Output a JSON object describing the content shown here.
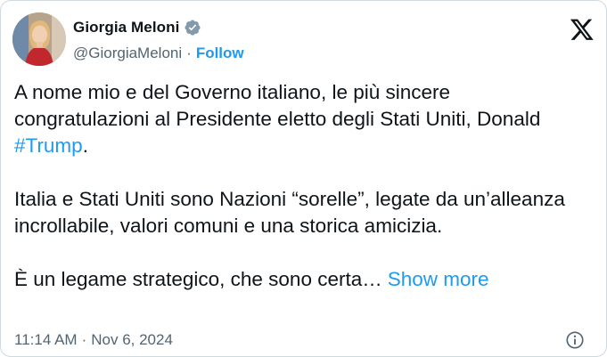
{
  "author": {
    "name": "Giorgia Meloni",
    "handle": "@GiorgiaMeloni",
    "separator": "·",
    "follow_label": "Follow",
    "verified_color": "#829aab",
    "avatar_icon": "avatar-photo"
  },
  "platform": {
    "logo_icon": "x-logo-icon"
  },
  "tweet": {
    "p1_text": "A nome mio e del Governo italiano, le più sincere congratulazioni al Presidente eletto degli Stati Uniti, Donald ",
    "p1_hashtag": "#Trump",
    "p1_end": ".",
    "p2": "Italia e Stati Uniti sono Nazioni “sorelle”, legate da un’alleanza incrollabile, valori comuni e una storica amicizia.",
    "p3": "È un legame strategico, che sono certa…",
    "show_more": "Show more"
  },
  "footer": {
    "time": "11:14 AM",
    "separator": "·",
    "date": "Nov 6, 2024",
    "info_icon": "info-icon"
  },
  "colors": {
    "accent": "#1d9bf0",
    "text": "#0f1419",
    "muted": "#536471"
  }
}
